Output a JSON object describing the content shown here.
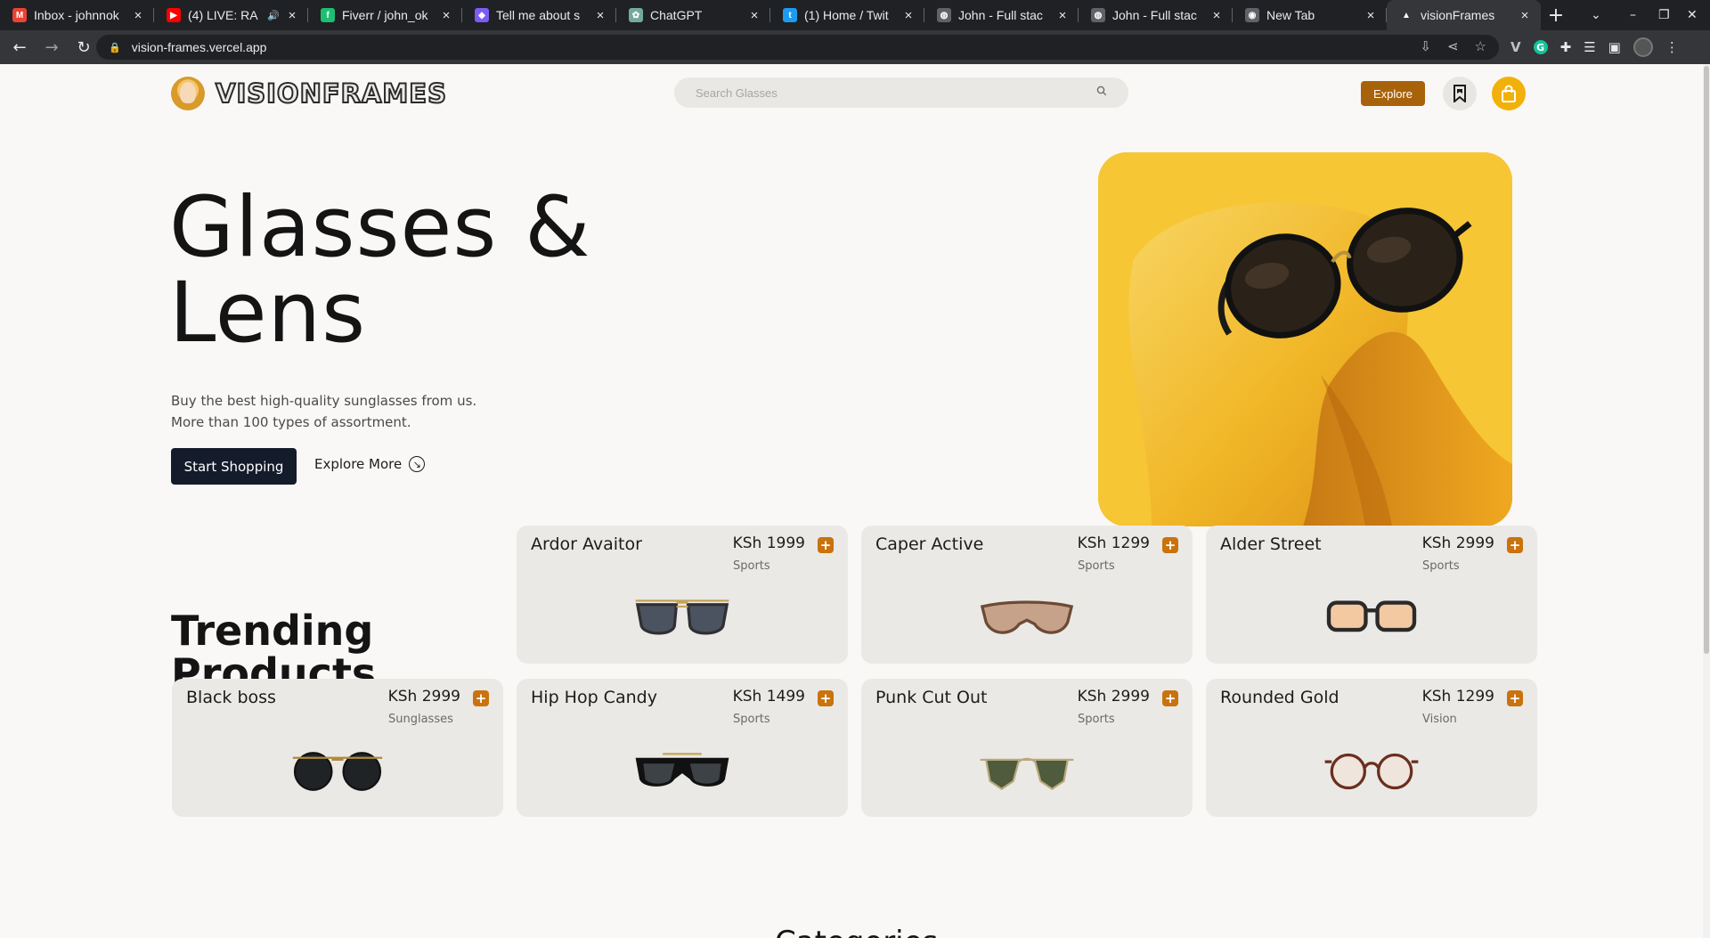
{
  "browser": {
    "tabs": [
      {
        "title": "Inbox - johnnok",
        "favicon": "gmail-icon",
        "color": "#ea4335"
      },
      {
        "title": "(4) LIVE: RA",
        "favicon": "youtube-icon",
        "color": "#ff0000",
        "audio": true
      },
      {
        "title": "Fiverr / john_ok",
        "favicon": "fiverr-icon",
        "color": "#1dbf73"
      },
      {
        "title": "Tell me about s",
        "favicon": "app-icon",
        "color": "#7b5cf5"
      },
      {
        "title": "ChatGPT",
        "favicon": "chatgpt-icon",
        "color": "#74aa9c"
      },
      {
        "title": "(1) Home / Twit",
        "favicon": "twitter-icon",
        "color": "#1d9bf0"
      },
      {
        "title": "John - Full stac",
        "favicon": "globe-icon",
        "color": "#5f6368"
      },
      {
        "title": "John - Full stac",
        "favicon": "globe-icon",
        "color": "#5f6368"
      },
      {
        "title": "New Tab",
        "favicon": "chrome-icon",
        "color": "#5f6368"
      },
      {
        "title": "visionFrames",
        "favicon": "vercel-icon",
        "color": "#35363a",
        "active": true
      }
    ],
    "url": "vision-frames.vercel.app"
  },
  "header": {
    "logo_text": "VISIONFRAMES",
    "search_placeholder": "Search Glasses",
    "explore_label": "Explore"
  },
  "hero": {
    "title_line1": "Glasses &",
    "title_line2": "Lens",
    "desc_line1": "Buy the best high-quality sunglasses from us.",
    "desc_line2": "More than 100 types of assortment.",
    "start_label": "Start Shopping",
    "explore_more_label": "Explore More"
  },
  "trending": {
    "title_line1": "Trending",
    "title_line2": "Products",
    "products": [
      {
        "name": "Ardor Avaitor",
        "price": "KSh 1999",
        "category": "Sports",
        "frame": "#2f3033",
        "lens": "#4b5360",
        "style": "aviator"
      },
      {
        "name": "Caper Active",
        "price": "KSh 1299",
        "category": "Sports",
        "frame": "#6d4a35",
        "lens": "#c7a28a",
        "style": "shield"
      },
      {
        "name": "Alder Street",
        "price": "KSh 2999",
        "category": "Sports",
        "frame": "#2a2a2a",
        "lens": "#f3c9a2",
        "style": "square"
      },
      {
        "name": "Black boss",
        "price": "KSh 2999",
        "category": "Sunglasses",
        "frame": "#b08a3c",
        "lens": "#1f2326",
        "style": "round"
      },
      {
        "name": "Hip Hop Candy",
        "price": "KSh 1499",
        "category": "Sports",
        "frame": "#111111",
        "lens": "#3d4247",
        "style": "wide"
      },
      {
        "name": "Punk Cut Out",
        "price": "KSh 2999",
        "category": "Sports",
        "frame": "#b9a87a",
        "lens": "#4e5b3c",
        "style": "hex"
      },
      {
        "name": "Rounded Gold",
        "price": "KSh 1299",
        "category": "Vision",
        "frame": "#6b2e1d",
        "lens": "#efe5dd",
        "style": "round-clear"
      }
    ]
  },
  "categories_peek": "Categories"
}
